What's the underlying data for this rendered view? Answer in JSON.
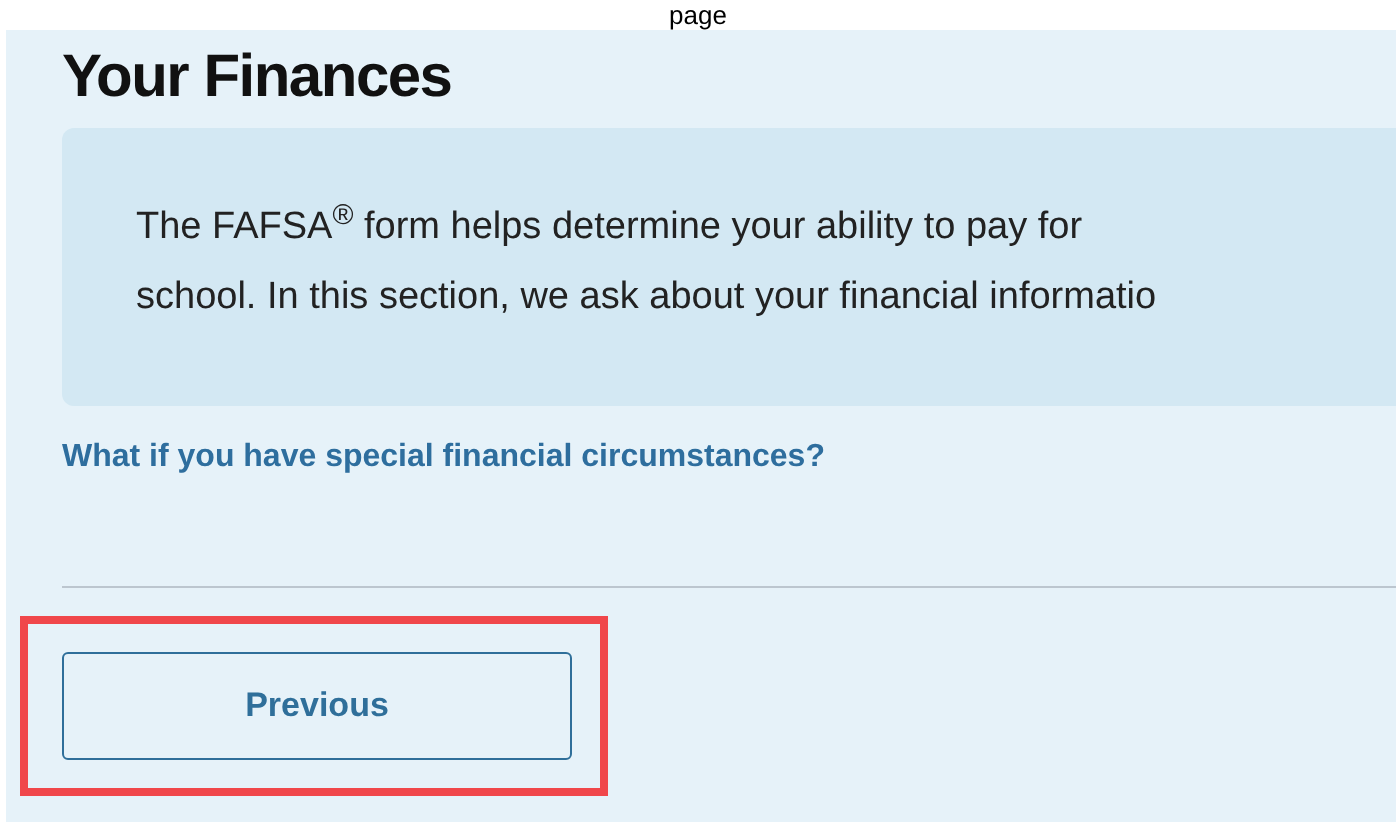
{
  "top_strip": {
    "text": "page"
  },
  "heading": "Your Finances",
  "info_box": {
    "lines": [
      "The FAFSA$^{®}$ form helps determine your ability to pay for",
      "school. In this section, we ask about your financial informatio"
    ]
  },
  "link": "What if you have special financial circumstances?",
  "buttons": [
    {
      "label": "Previous",
      "highlighted": true
    }
  ]
}
